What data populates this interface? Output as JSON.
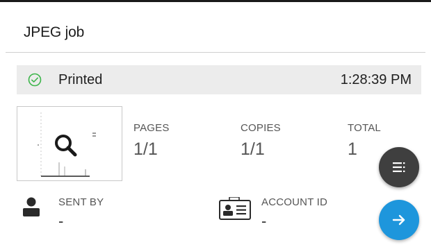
{
  "job": {
    "title": "JPEG job"
  },
  "status": {
    "text": "Printed",
    "time": "1:28:39 PM",
    "icon": "check-circle-icon",
    "color": "#3cb54a"
  },
  "stats": {
    "pages_label": "PAGES",
    "pages_value": "1/1",
    "copies_label": "COPIES",
    "copies_value": "1/1",
    "total_label": "TOTAL",
    "total_value": "1"
  },
  "info": {
    "sent_by_label": "SENT BY",
    "sent_by_value": "-",
    "sent_by_icon": "person-icon",
    "account_label": "ACCOUNT ID",
    "account_value": "-",
    "account_icon": "id-card-icon"
  },
  "actions": {
    "menu_icon": "list-menu-icon",
    "next_icon": "arrow-right-icon",
    "menu_color": "#3f3f3f",
    "next_color": "#1e96dc"
  }
}
